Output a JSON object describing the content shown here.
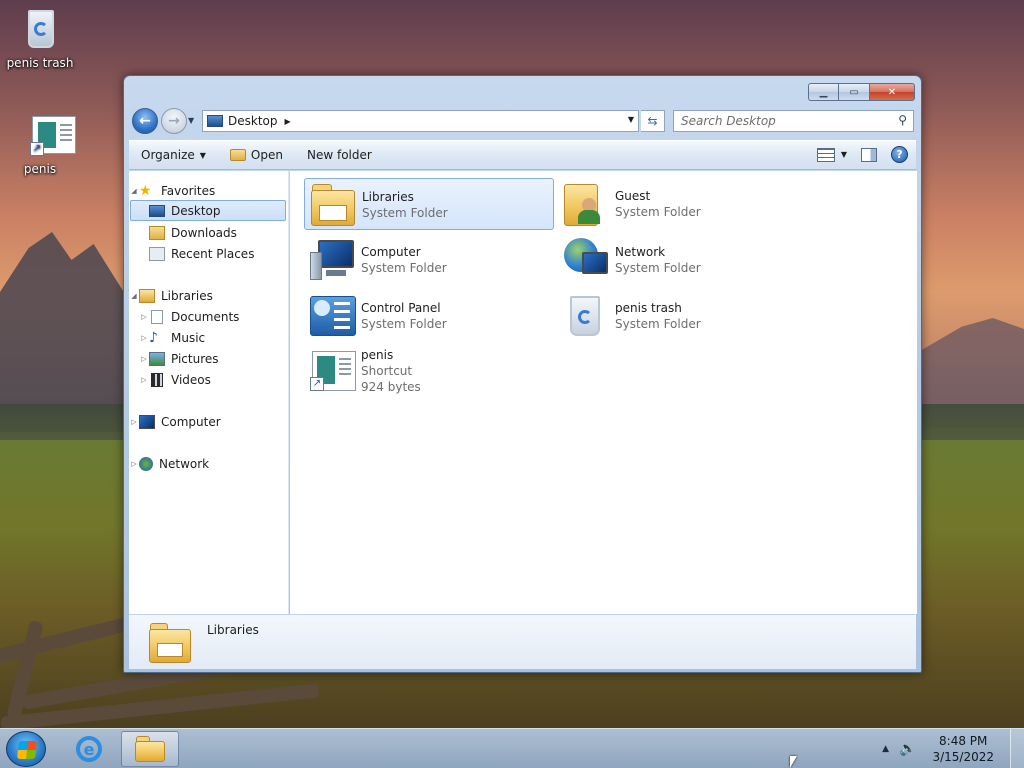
{
  "desktop": {
    "icons": [
      {
        "label": "penis trash"
      },
      {
        "label": "penis"
      }
    ]
  },
  "window": {
    "caption_buttons": {
      "minimize": "▁",
      "maximize": "▭",
      "close": "✕"
    },
    "address": {
      "crumb": "Desktop"
    },
    "search": {
      "placeholder": "Search Desktop"
    },
    "commands": {
      "organize": "Organize",
      "open": "Open",
      "new_folder": "New folder"
    },
    "nav": {
      "favorites": "Favorites",
      "desktop": "Desktop",
      "downloads": "Downloads",
      "recent": "Recent Places",
      "libraries": "Libraries",
      "documents": "Documents",
      "music": "Music",
      "pictures": "Pictures",
      "videos": "Videos",
      "computer": "Computer",
      "network": "Network"
    },
    "items": [
      {
        "name": "Libraries",
        "sub": "System Folder"
      },
      {
        "name": "Guest",
        "sub": "System Folder"
      },
      {
        "name": "Computer",
        "sub": "System Folder"
      },
      {
        "name": "Network",
        "sub": "System Folder"
      },
      {
        "name": "Control Panel",
        "sub": "System Folder"
      },
      {
        "name": "penis trash",
        "sub": "System Folder"
      },
      {
        "name": "penis",
        "sub": "Shortcut",
        "size": "924 bytes"
      }
    ],
    "details": {
      "name": "Libraries"
    }
  },
  "taskbar": {
    "clock_time": "8:48 PM",
    "clock_date": "3/15/2022",
    "help_glyph": "?"
  }
}
